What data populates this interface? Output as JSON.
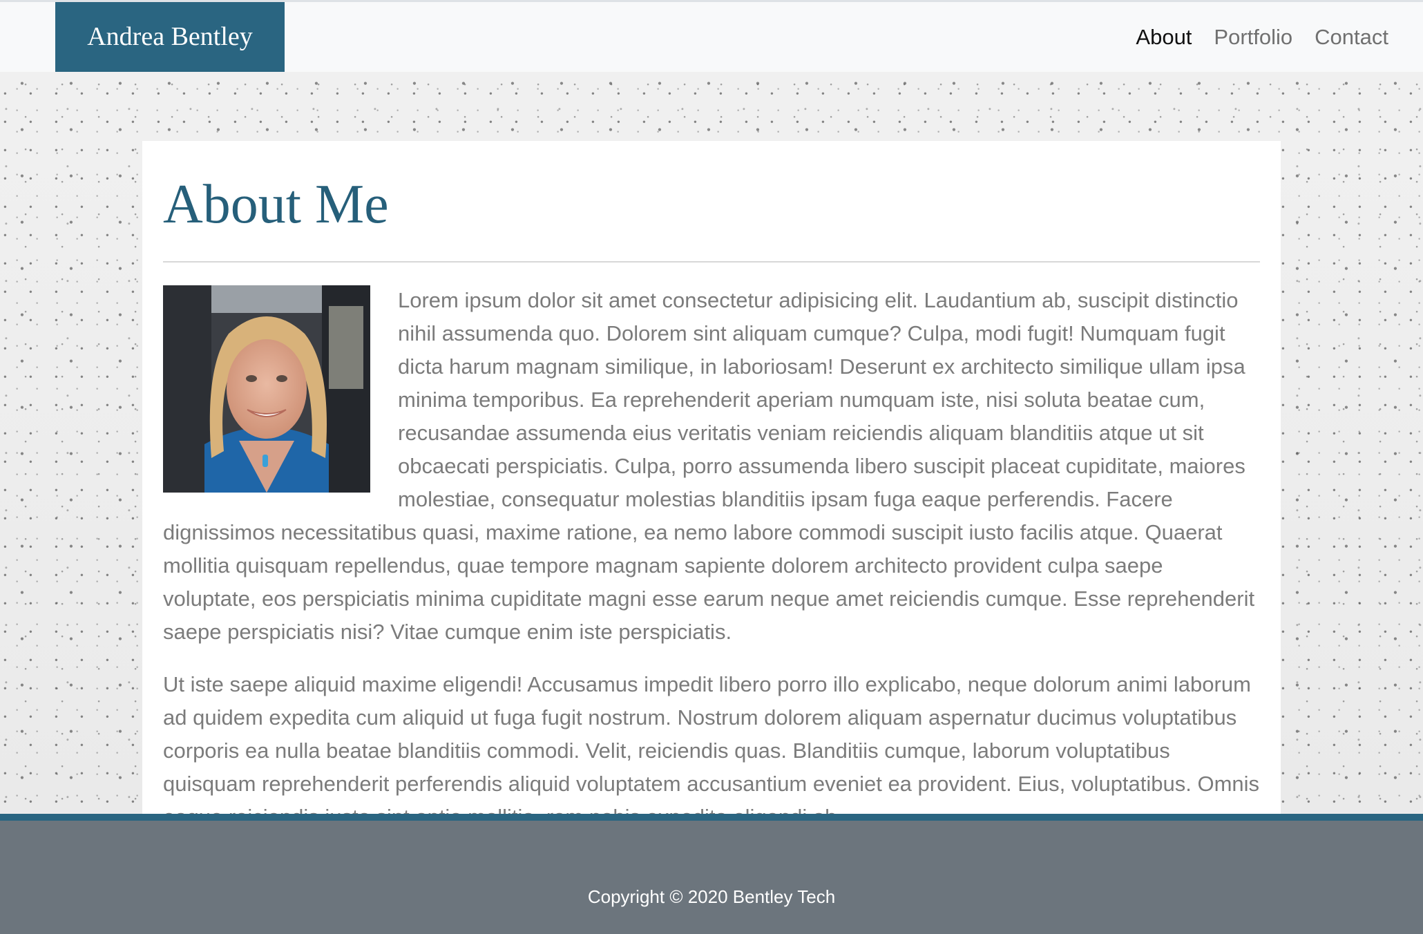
{
  "header": {
    "brand": "Andrea Bentley",
    "nav": [
      {
        "label": "About",
        "active": true
      },
      {
        "label": "Portfolio",
        "active": false
      },
      {
        "label": "Contact",
        "active": false
      }
    ]
  },
  "main": {
    "title": "About Me",
    "photo_alt": "Portrait of Andrea Bentley",
    "paragraphs": [
      "Lorem ipsum dolor sit amet consectetur adipisicing elit. Laudantium ab, suscipit distinctio nihil assumenda quo. Dolorem sint aliquam cumque? Culpa, modi fugit! Numquam fugit dicta harum magnam similique, in laboriosam! Deserunt ex architecto similique ullam ipsa minima temporibus. Ea reprehenderit aperiam numquam iste, nisi soluta beatae cum, recusandae assumenda eius veritatis veniam reiciendis aliquam blanditiis atque ut sit obcaecati perspiciatis. Culpa, porro assumenda libero suscipit placeat cupiditate, maiores molestiae, consequatur molestias blanditiis ipsam fuga eaque perferendis. Facere dignissimos necessitatibus quasi, maxime ratione, ea nemo labore commodi suscipit iusto facilis atque. Quaerat mollitia quisquam repellendus, quae tempore magnam sapiente dolorem architecto provident culpa saepe voluptate, eos perspiciatis minima cupiditate magni esse earum neque amet reiciendis cumque. Esse reprehenderit saepe perspiciatis nisi? Vitae cumque enim iste perspiciatis.",
      "Ut iste saepe aliquid maxime eligendi! Accusamus impedit libero porro illo explicabo, neque dolorum animi laborum ad quidem expedita cum aliquid ut fuga fugit nostrum. Nostrum dolorem aliquam aspernatur ducimus voluptatibus corporis ea nulla beatae blanditiis commodi. Velit, reiciendis quas. Blanditiis cumque, laborum voluptatibus quisquam reprehenderit perferendis aliquid voluptatem accusantium eveniet ea provident. Eius, voluptatibus. Omnis eaque reiciendis iusto sint optio mollitia, rem nobis expedita eligendi ab."
    ]
  },
  "footer": {
    "copyright": "Copyright © 2020 Bentley Tech"
  },
  "colors": {
    "brand": "#2a6581",
    "title": "#265f7a",
    "footer": "#6c757d",
    "body_text": "#7b7b7b"
  }
}
